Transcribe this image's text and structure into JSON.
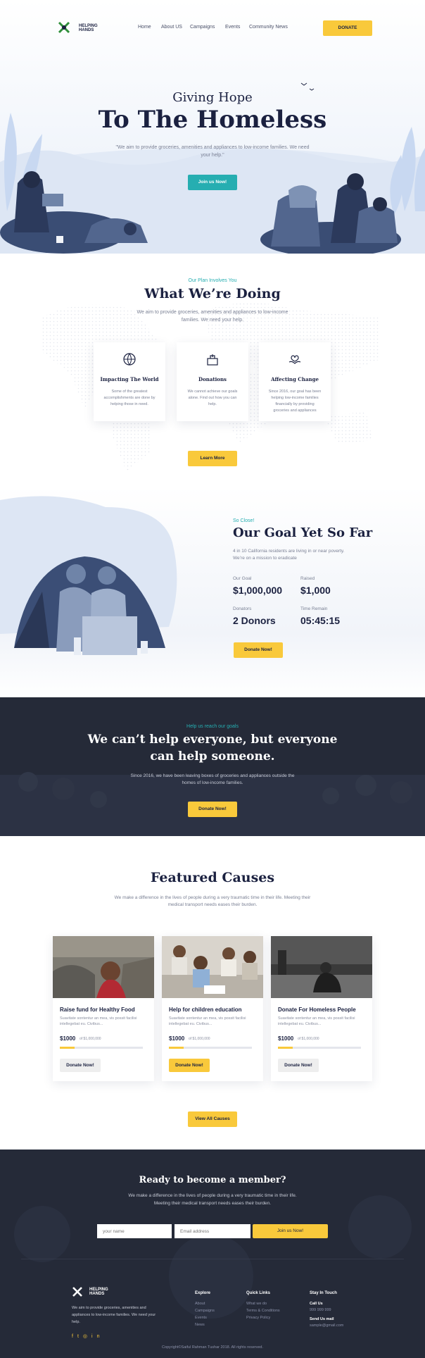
{
  "brand": {
    "line1": "HELPING",
    "line2": "HANDS"
  },
  "nav": {
    "items": [
      "Home",
      "About US",
      "Campaigns",
      "Events",
      "Community News"
    ],
    "donate_label": "DONATE"
  },
  "hero": {
    "kicker": "Giving Hope",
    "title": "To The Homeless",
    "description": "\"We aim to provide groceries, amenities and appliances to low-income families. We need your help.\"",
    "button_label": "Join us Now!"
  },
  "doing": {
    "eyebrow": "Our Plan Involves You",
    "title": "What We’re Doing",
    "description": "We aim to provide groceries, amenities and appliances to low-income families. We need your help.",
    "cards": [
      {
        "icon": "globe-icon",
        "title": "Impacting The World",
        "text": "Some of the greatest accomplishments are done by helping those in need."
      },
      {
        "icon": "donation-box-icon",
        "title": "Donations",
        "text": "We cannot achieve our goals alone. Find out how you can help."
      },
      {
        "icon": "heart-hands-icon",
        "title": "Affecting Change",
        "text": "Since 2016, our goal has been helping low-income families financially by providing groceries and appliances"
      }
    ],
    "button_label": "Learn More"
  },
  "goal": {
    "eyebrow": "So Close!",
    "title": "Our Goal Yet So Far",
    "description": "4 in 10 California residents are living in or near poverty. We’re on a mission to eradicate",
    "stats": {
      "goal_label": "Our Goal",
      "goal_value": "$1,000,000",
      "raised_label": "Raised",
      "raised_value": "$1,000",
      "donors_label": "Donators",
      "donors_value": "2 Donors",
      "time_label": "Time Remain",
      "time_value": "05:45:15"
    },
    "button_label": "Donate Now!"
  },
  "cta": {
    "eyebrow": "Help us reach our goals",
    "title_line1": "We can’t help everyone, but everyone",
    "title_line2": "can help someone.",
    "description": "Since 2016, we have been leaving boxes of groceries and appliances outside the homes of low-income families.",
    "button_label": "Donate Now!"
  },
  "causes": {
    "title": "Featured Causes",
    "description": "We make a difference in the lives of people during a very traumatic time in their life. Meeting their medical transport needs eases their burden.",
    "items": [
      {
        "title": "Raise fund for Healthy Food",
        "text": "Suavitate sontentur an mea, vis possit facilisi intellegebat eu. Civibus...",
        "amount": "$1000",
        "goal": "of $1,000,000",
        "progress": 0.18,
        "button": "Donate Now!"
      },
      {
        "title": "Help for children education",
        "text": "Suavitate sontentur an mea, vis possit facilisi intellegebat eu. Civibus...",
        "amount": "$1000",
        "goal": "of $1,000,000",
        "progress": 0.18,
        "button": "Donate Now!"
      },
      {
        "title": "Donate For Homeless People",
        "text": "Suavitate sontentur an mea, vis possit facilisi intellegebat eu. Civibus...",
        "amount": "$1000",
        "goal": "of $1,000,000",
        "progress": 0.18,
        "button": "Donate Now!"
      }
    ],
    "view_all_label": "View All Causes"
  },
  "member": {
    "title": "Ready to become a member?",
    "description_line1": "We make a difference in the lives of people during a very traumatic time in their life.",
    "description_line2": "Meeting their medical transport needs eases their burden.",
    "name_placeholder": "your name",
    "email_placeholder": "Email address",
    "button_label": "Join us Now!"
  },
  "footer": {
    "about": "We aim to provide groceries, amenities and appliances to low-income families. We need your help.",
    "explore_title": "Explore",
    "explore": [
      "About",
      "Campaigns",
      "Events",
      "News"
    ],
    "quick_title": "Quick Links",
    "quick": [
      "What we do",
      "Terms & Conditions",
      "Privacy Policy"
    ],
    "touch_title": "Stay In Touch",
    "call_label": "Call Us",
    "call_value": "999 999 999",
    "mail_label": "Send Us mail",
    "mail_value": "sample@gmail.com",
    "copyright": "Copyright©Saiful Rahman Tushar 2018. All rights reserved."
  },
  "colors": {
    "accent": "#f9c93b",
    "teal": "#26aeb1",
    "navy": "#1b2140",
    "dark_bg": "#252a38"
  }
}
